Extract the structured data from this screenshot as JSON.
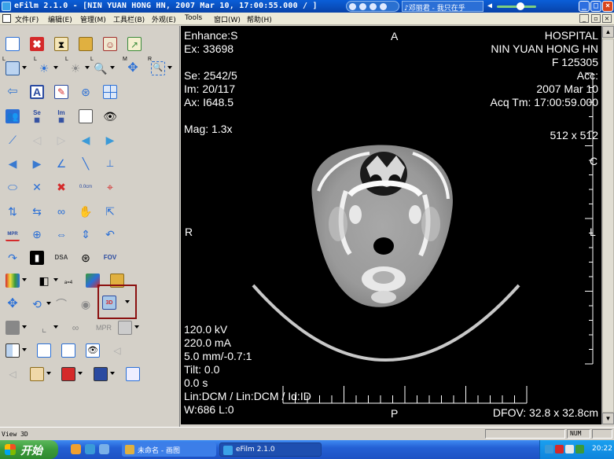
{
  "window": {
    "title": "eFilm 2.1.0 - [NIN YUAN HONG HN, 2007 Mar 10, 17:00:55.000  /  ]",
    "now_playing": "♪邓丽君 - 我只在乎",
    "volume_level": 0.6
  },
  "menu": {
    "items": [
      "文件(F)",
      "编辑(E)",
      "管理(M)",
      "工具栏(B)",
      "外观(E)",
      "Tools",
      "窗口(W)",
      "帮助(H)"
    ]
  },
  "toolbar": {
    "icons": [
      {
        "name": "open-study-icon",
        "color": "#2a6fd6"
      },
      {
        "name": "delete-icon",
        "color": "#d42a2a"
      },
      {
        "name": "hourglass-icon",
        "color": "#c89a2a"
      },
      {
        "name": "folder-icon",
        "color": "#e0b040"
      },
      {
        "name": "portrait-icon",
        "color": "#a02a2a"
      },
      {
        "name": "export-icon",
        "color": "#3a8a3a"
      }
    ],
    "labels": {
      "se": "Se",
      "im": "Im",
      "dsa": "DSA",
      "fov": "FOV",
      "mpr": "MPR",
      "a4": "a=4",
      "r": "R",
      "l": "L",
      "three_d": "3D",
      "length": "0.0cm"
    }
  },
  "overlay": {
    "top_left": [
      "Enhance:S",
      "Ex: 33698",
      "",
      "Se: 2542/5",
      "Im: 20/117",
      "Ax: I648.5",
      "",
      "Mag: 1.3x"
    ],
    "top_right": [
      "HOSPITAL",
      "NIN YUAN HONG HN",
      "F  125305",
      "Acc:",
      "2007 Mar 10",
      "Acq Tm: 17:00:59.000",
      "",
      "",
      "512 x 512"
    ],
    "bottom_left": [
      "120.0 kV",
      "220.0 mA",
      "5.0 mm/-0.7:1",
      "Tilt: 0.0",
      "0.0 s",
      "Lin:DCM / Lin:DCM / Id:ID",
      "W:686  L:0"
    ],
    "bottom_right": "DFOV: 32.8 x 32.8cm",
    "orientation": {
      "top": "A",
      "bottom": "P",
      "left": "R",
      "right": "L",
      "right_top": "C"
    }
  },
  "status": {
    "message": "View 3D",
    "num": "NUM"
  },
  "taskbar": {
    "start": "开始",
    "tasks": [
      {
        "label": "未命名 - 画图"
      },
      {
        "label": "eFilm 2.1.0"
      }
    ],
    "clock": "20:22"
  },
  "colors": {
    "titlebar": "#0a5fd8",
    "viewer_bg": "#000000",
    "selection_border": "#8b1010"
  }
}
